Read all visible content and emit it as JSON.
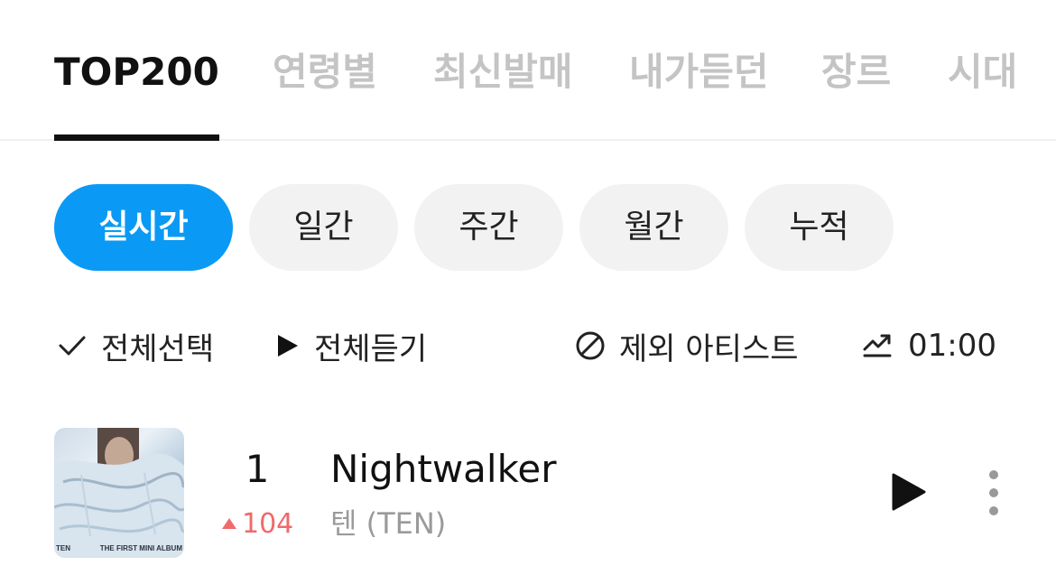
{
  "top_tabs": [
    "TOP200",
    "연령별",
    "최신발매",
    "내가듣던",
    "장르",
    "시대"
  ],
  "period_tabs": [
    "실시간",
    "일간",
    "주간",
    "월간",
    "누적"
  ],
  "toolbar": {
    "select_all": "전체선택",
    "play_all": "전체듣기",
    "exclude_artist": "제외 아티스트",
    "time": "01:00"
  },
  "song": {
    "rank": "1",
    "rank_change": "104",
    "title": "Nightwalker",
    "artist": "텐 (TEN)",
    "cover_text_left": "TEN",
    "cover_text_right": "THE FIRST MINI ALBUM"
  },
  "colors": {
    "accent": "#0a9af5",
    "rank_up": "#f06a6a"
  }
}
